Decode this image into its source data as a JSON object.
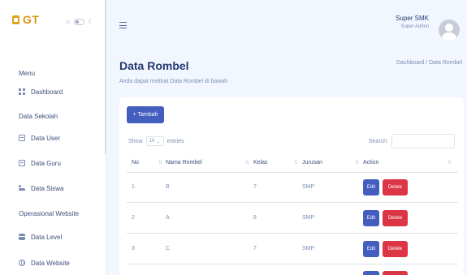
{
  "brand": {
    "text": "GT"
  },
  "theme_toggle": {
    "sun": "☼",
    "moon": "☾"
  },
  "sidebar": {
    "menu_title": "Menu",
    "dashboard": "Dashboard",
    "section_sekolah": "Data Sekolah",
    "items_sekolah": [
      "Data User",
      "Data Guru",
      "Data Siswa"
    ],
    "section_operasional": "Operasional Website",
    "items_operasional": [
      "Data Level",
      "Data Website"
    ]
  },
  "header": {
    "user_name": "Super SMK",
    "user_role": "Super Admin"
  },
  "page": {
    "title": "Data Rombel",
    "subtitle": "Anda dapat melihat Data Rombel di bawah",
    "breadcrumb": "Dashboard / Data Rombel"
  },
  "table_controls": {
    "add_label": "+ Tambah",
    "show_label": "Show",
    "entries_value": "10",
    "entries_label": "entries",
    "search_label": "Search:"
  },
  "table": {
    "columns": [
      "No",
      "Nama Rombel",
      "Kelas",
      "Jurusan",
      "Action"
    ],
    "rows": [
      [
        "1",
        "B",
        "7",
        "SMP"
      ],
      [
        "2",
        "A",
        "8",
        "SMP"
      ],
      [
        "3",
        "C",
        "7",
        "SMP"
      ]
    ],
    "edit_label": "Edit",
    "delete_label": "Delete"
  },
  "colors": {
    "primary": "#435ebe",
    "danger": "#dc3545",
    "brand": "#d99616"
  }
}
